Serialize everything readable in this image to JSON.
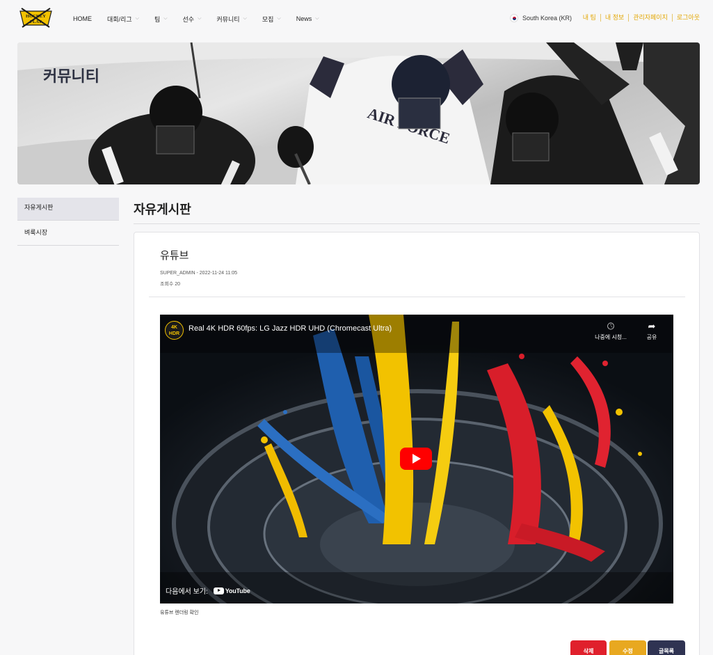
{
  "header": {
    "logo_text": [
      "HOCKEY",
      "PLAY"
    ],
    "nav": [
      {
        "label": "HOME",
        "dropdown": false
      },
      {
        "label": "대회/리그",
        "dropdown": true
      },
      {
        "label": "팀",
        "dropdown": true
      },
      {
        "label": "선수",
        "dropdown": true
      },
      {
        "label": "커뮤니티",
        "dropdown": true
      },
      {
        "label": "모집",
        "dropdown": true
      },
      {
        "label": "News",
        "dropdown": true
      }
    ],
    "country": "South Korea (KR)",
    "user_links": [
      "내 팀",
      "내 정보",
      "관리자페이지",
      "로그아웃"
    ],
    "accent_color": "#e3a600"
  },
  "banner": {
    "title": "커뮤니티"
  },
  "sidebar": {
    "items": [
      {
        "label": "자유게시판",
        "active": true
      },
      {
        "label": "벼룩시장",
        "active": false
      }
    ]
  },
  "board": {
    "title": "자유게시판"
  },
  "post": {
    "title": "유튜브",
    "meta": "SUPER_ADMIN - 2022-11-24 11:05",
    "views": "조회수 20",
    "caption": "유튜브 렌더링 확인"
  },
  "video": {
    "channel_badge": "4K HDR",
    "title": "Real 4K HDR 60fps: LG Jazz HDR UHD (Chromecast Ultra)",
    "watch_later": "나중에 시청...",
    "share": "공유",
    "watch_on": "다음에서 보기:",
    "youtube": "YouTube"
  },
  "actions": {
    "delete": "삭제",
    "edit": "수정",
    "list": "글목록",
    "colors": {
      "delete": "#e0202c",
      "edit": "#e8a820",
      "list": "#2f3352"
    }
  }
}
